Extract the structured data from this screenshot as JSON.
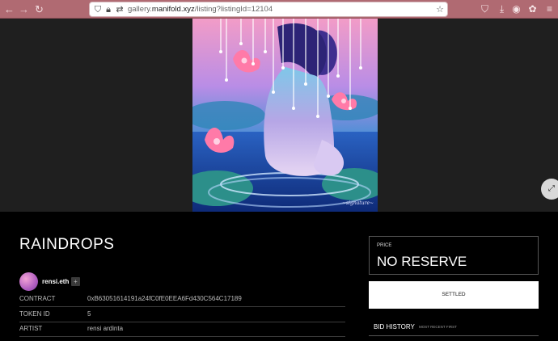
{
  "browser": {
    "url_prefix": "gallery.",
    "url_domain": "manifold.xyz",
    "url_path": "/listing?listingId=12104",
    "colors": {
      "toolbar": "#b06a72"
    }
  },
  "listing": {
    "title": "RAINDROPS",
    "artist_handle": "rensi.eth",
    "more_label": "+",
    "rows": [
      {
        "label": "CONTRACT",
        "value": "0xB63051614191a24fC0fE0EEA6Fd430C564C17189"
      },
      {
        "label": "TOKEN ID",
        "value": "5"
      },
      {
        "label": "ARTIST",
        "value": "rensi ardinta"
      }
    ]
  },
  "sale": {
    "price_label": "PRICE",
    "price_value": "NO RESERVE",
    "status_button": "SETTLED",
    "bid_history_title": "BID HISTORY",
    "bid_history_sort": "MOST RECENT FIRST"
  },
  "icons": {
    "back": "back-arrow-icon",
    "forward": "forward-arrow-icon",
    "reload": "reload-icon",
    "expand": "expand-icon"
  }
}
